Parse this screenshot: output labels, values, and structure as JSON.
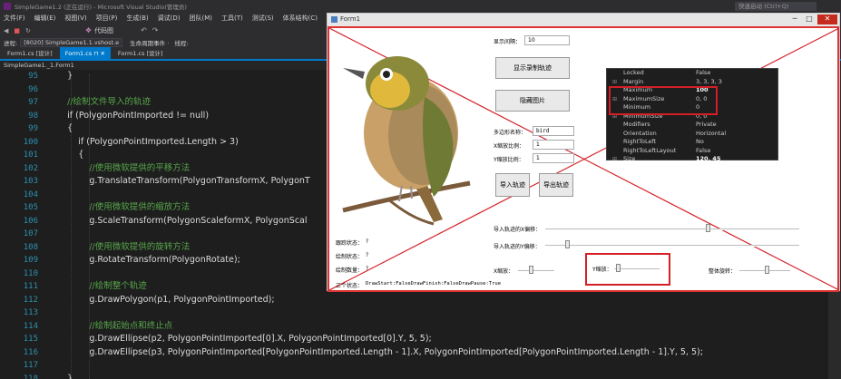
{
  "vs": {
    "title": "SimpleGame1.2 (正在运行) - Microsoft Visual Studio(管理员)",
    "quick_launch": "快速启动 (Ctrl+Q)",
    "menu": [
      "文件(F)",
      "编辑(E)",
      "视图(V)",
      "项目(P)",
      "生成(B)",
      "调试(D)",
      "团队(M)",
      "工具(T)",
      "测试(S)",
      "体系结构(C)",
      "分析(N)",
      "窗口(W)"
    ],
    "toolbar_code_label": "代码图",
    "process_label": "进程:",
    "process_value": "[8020] SimpleGame1.1.vshost.e",
    "lifecycle_label": "生命周期事件 ·",
    "thread_label": "线程:",
    "tabs": [
      "Form1.cs [设计]",
      "Form1.cs",
      "Form1.cs [设计]"
    ],
    "nav_left": "SimpleGame1._1.Form1",
    "line_numbers": [
      "95",
      "96",
      "97",
      "98",
      "99",
      "100",
      "101",
      "102",
      "103",
      "104",
      "105",
      "106",
      "107",
      "108",
      "109",
      "110",
      "111",
      "112",
      "113",
      "114",
      "115",
      "116",
      "117",
      "118"
    ],
    "code": [
      {
        "text": "        }",
        "cls": ""
      },
      {
        "text": "",
        "cls": ""
      },
      {
        "text": "        //绘制文件导入的轨迹",
        "cls": "cmt"
      },
      {
        "text": "        if (PolygonPointImported != null)",
        "cls": ""
      },
      {
        "text": "        {",
        "cls": ""
      },
      {
        "text": "            if (PolygonPointImported.Length > 3)",
        "cls": ""
      },
      {
        "text": "            {",
        "cls": ""
      },
      {
        "text": "                //使用微软提供的平移方法",
        "cls": "cmt"
      },
      {
        "text": "                g.TranslateTransform(PolygonTransformX, PolygonT",
        "cls": ""
      },
      {
        "text": "",
        "cls": ""
      },
      {
        "text": "                //使用微软提供的缩放方法",
        "cls": "cmt"
      },
      {
        "text": "                g.ScaleTransform(PolygonScaleformX, PolygonScal",
        "cls": ""
      },
      {
        "text": "",
        "cls": ""
      },
      {
        "text": "                //使用微软提供的旋转方法",
        "cls": "cmt"
      },
      {
        "text": "                g.RotateTransform(PolygonRotate);",
        "cls": ""
      },
      {
        "text": "",
        "cls": ""
      },
      {
        "text": "                //绘制整个轨迹",
        "cls": "cmt"
      },
      {
        "text": "                g.DrawPolygon(p1, PolygonPointImported);",
        "cls": ""
      },
      {
        "text": "",
        "cls": ""
      },
      {
        "text": "                //绘制起始点和终止点",
        "cls": "cmt"
      },
      {
        "text": "                g.DrawEllipse(p2, PolygonPointImported[0].X, PolygonPointImported[0].Y, 5, 5);",
        "cls": ""
      },
      {
        "text": "                g.DrawEllipse(p3, PolygonPointImported[PolygonPointImported.Length - 1].X, PolygonPointImported[PolygonPointImported.Length - 1].Y, 5, 5);",
        "cls": ""
      },
      {
        "text": "",
        "cls": ""
      },
      {
        "text": "        }",
        "cls": ""
      }
    ]
  },
  "form": {
    "title": "Form1",
    "display_interval_label": "显示间隔：",
    "display_interval_value": "10",
    "btn_show_track": "显示录制轨迹",
    "btn_hide_image": "隐藏图片",
    "polygon_name_label": "多边形名称：",
    "polygon_name_value": "bird",
    "x_scale_label": "X缩放比例：",
    "x_scale_value": "1",
    "y_scale_label": "Y缩放比例：",
    "y_scale_value": "1",
    "btn_import": "导入轨迹",
    "btn_export": "导出轨迹",
    "import_x_offset_label": "导入轨迹的X偏移：",
    "import_y_offset_label": "导入轨迹的Y偏移：",
    "x_scale_slider_label": "X缩放：",
    "y_scale_slider_label": "Y缩放：",
    "rotate_label": "整体旋转：",
    "status": [
      {
        "label": "跟踪状态：",
        "value": "?"
      },
      {
        "label": "绘制状态：",
        "value": "?"
      },
      {
        "label": "绘制数量：",
        "value": "?"
      }
    ],
    "tri_status_label": "三个状态：",
    "tri_status_value": "DrawStart:FalseDrawFinish:FalseDrawPause:True"
  },
  "properties": {
    "rows": [
      {
        "k": "Locked",
        "v": "False",
        "bold": false
      },
      {
        "k": "Margin",
        "v": "3, 3, 3, 3",
        "bold": false
      },
      {
        "k": "Maximum",
        "v": "100",
        "bold": true
      },
      {
        "k": "MaximumSize",
        "v": "0, 0",
        "bold": false
      },
      {
        "k": "Minimum",
        "v": "0",
        "bold": false
      },
      {
        "k": "MinimumSize",
        "v": "0, 0",
        "bold": false
      },
      {
        "k": "Modifiers",
        "v": "Private",
        "bold": false
      },
      {
        "k": "Orientation",
        "v": "Horizontal",
        "bold": false
      },
      {
        "k": "RightToLeft",
        "v": "No",
        "bold": false
      },
      {
        "k": "RightToLeftLayout",
        "v": "False",
        "bold": false
      },
      {
        "k": "Size",
        "v": "120, 45",
        "bold": true
      }
    ]
  },
  "colors": {
    "accent": "#007acc",
    "highlight_red": "#d41f26",
    "comment": "#57a64a",
    "keyword": "#569cd6"
  }
}
